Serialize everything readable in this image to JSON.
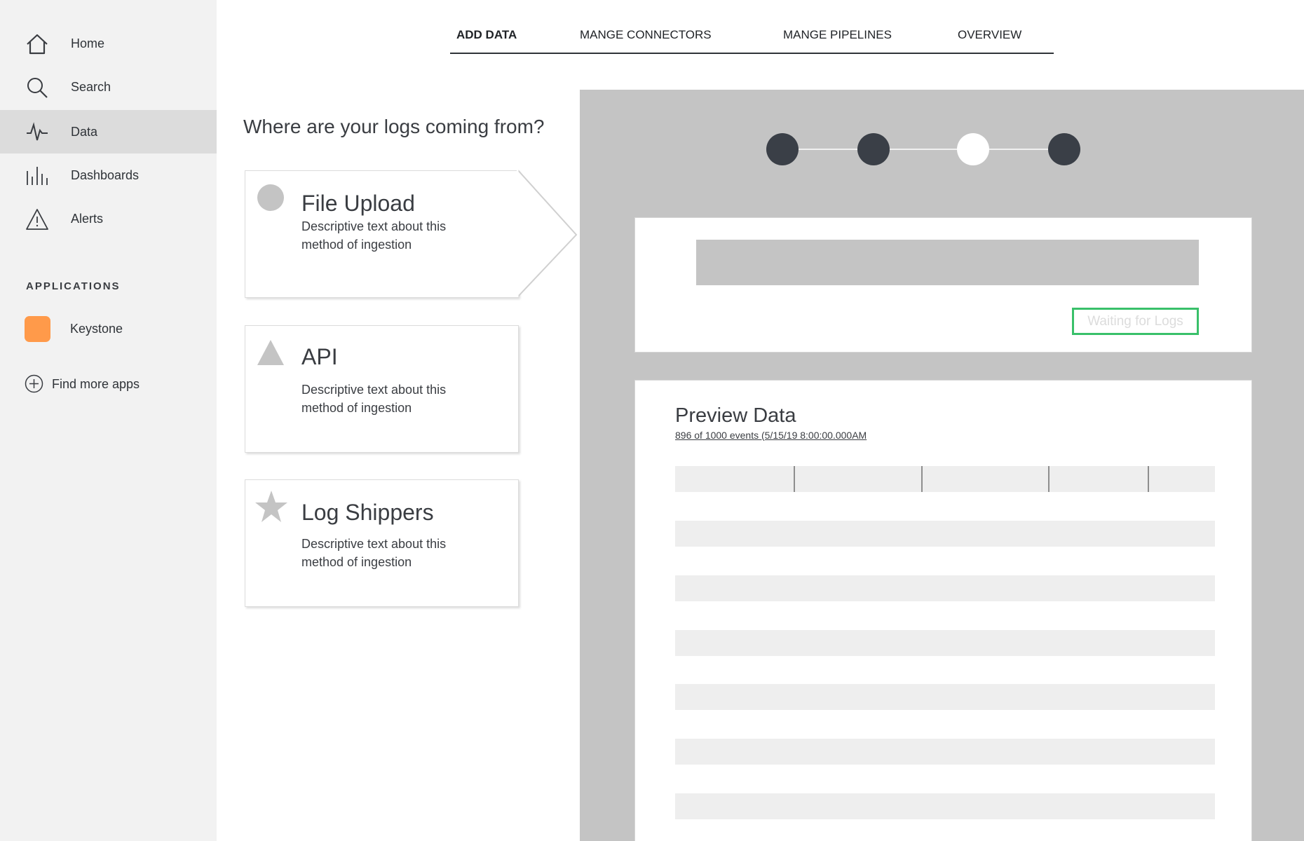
{
  "sidebar": {
    "nav": [
      {
        "label": "Home",
        "icon": "home-icon"
      },
      {
        "label": "Search",
        "icon": "search-icon"
      },
      {
        "label": "Data",
        "icon": "activity-icon",
        "active": true
      },
      {
        "label": "Dashboards",
        "icon": "bars-icon"
      },
      {
        "label": "Alerts",
        "icon": "alert-triangle-icon"
      }
    ],
    "applications_heading": "APPLICATIONS",
    "apps": [
      {
        "label": "Keystone",
        "color": "#ff9a4a"
      }
    ],
    "find_more_label": "Find more apps"
  },
  "tabs": [
    {
      "label": "ADD DATA",
      "active": true
    },
    {
      "label": "MANGE CONNECTORS"
    },
    {
      "label": "MANGE PIPELINES"
    },
    {
      "label": "OVERVIEW"
    }
  ],
  "main": {
    "question": "Where are your logs coming from?",
    "methods": [
      {
        "title": "File Upload",
        "description": "Descriptive text about  this method of ingestion",
        "icon": "circle-icon",
        "selected": true
      },
      {
        "title": "API",
        "description": "Descriptive text about  this method of ingestion",
        "icon": "triangle-icon"
      },
      {
        "title": "Log Shippers",
        "description": "Descriptive text about  this method of ingestion",
        "icon": "star-icon"
      }
    ]
  },
  "panel": {
    "stepper": {
      "steps": 4,
      "current_step": 3
    },
    "waiting_button": "Waiting for Logs",
    "preview": {
      "title": "Preview Data",
      "subtitle": "896 of 1000 events (5/15/19 8:00:00.000AM",
      "columns": 5,
      "rows": 6
    }
  },
  "colors": {
    "accent": "#39c06a",
    "app_swatch": "#ff9a4a",
    "step_dot": "#3a3f47",
    "panel_bg": "#c4c4c4"
  }
}
